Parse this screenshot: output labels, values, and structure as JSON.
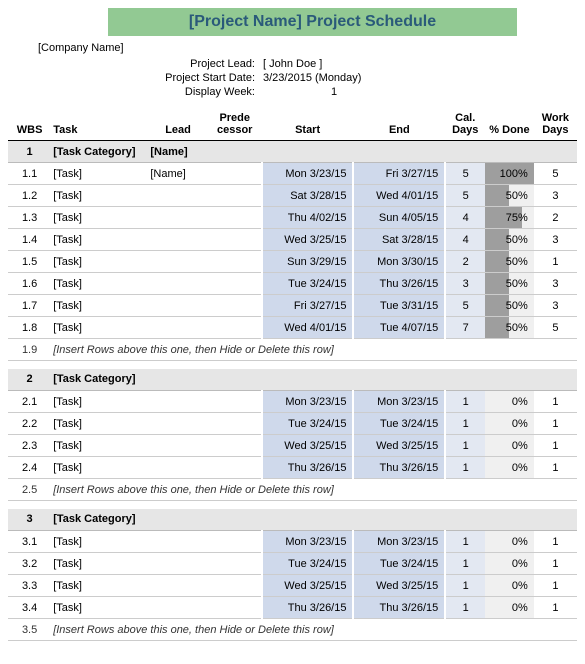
{
  "title": "[Project Name] Project Schedule",
  "company": "[Company Name]",
  "meta": {
    "lead_label": "Project Lead:",
    "lead_value": "[ John Doe ]",
    "start_label": "Project Start Date:",
    "start_value": "3/23/2015 (Monday)",
    "week_label": "Display Week:",
    "week_value": "1"
  },
  "headers": {
    "wbs": "WBS",
    "task": "Task",
    "lead": "Lead",
    "pred": "Prede cessor",
    "start": "Start",
    "end": "End",
    "cal": "Cal. Days",
    "pct": "% Done",
    "work": "Work Days"
  },
  "sections": [
    {
      "wbs": "1",
      "category": "[Task Category]",
      "lead": "[Name]",
      "rows": [
        {
          "wbs": "1.1",
          "task": "[Task]",
          "lead": "[Name]",
          "start": "Mon 3/23/15",
          "end": "Fri 3/27/15",
          "cal": "5",
          "pct": "100%",
          "pct_num": 100,
          "work": "5"
        },
        {
          "wbs": "1.2",
          "task": "[Task]",
          "lead": "",
          "start": "Sat 3/28/15",
          "end": "Wed 4/01/15",
          "cal": "5",
          "pct": "50%",
          "pct_num": 50,
          "work": "3"
        },
        {
          "wbs": "1.3",
          "task": "[Task]",
          "lead": "",
          "start": "Thu 4/02/15",
          "end": "Sun 4/05/15",
          "cal": "4",
          "pct": "75%",
          "pct_num": 75,
          "work": "2"
        },
        {
          "wbs": "1.4",
          "task": "[Task]",
          "lead": "",
          "start": "Wed 3/25/15",
          "end": "Sat 3/28/15",
          "cal": "4",
          "pct": "50%",
          "pct_num": 50,
          "work": "3"
        },
        {
          "wbs": "1.5",
          "task": "[Task]",
          "lead": "",
          "start": "Sun 3/29/15",
          "end": "Mon 3/30/15",
          "cal": "2",
          "pct": "50%",
          "pct_num": 50,
          "work": "1"
        },
        {
          "wbs": "1.6",
          "task": "[Task]",
          "lead": "",
          "start": "Tue 3/24/15",
          "end": "Thu 3/26/15",
          "cal": "3",
          "pct": "50%",
          "pct_num": 50,
          "work": "3"
        },
        {
          "wbs": "1.7",
          "task": "[Task]",
          "lead": "",
          "start": "Fri 3/27/15",
          "end": "Tue 3/31/15",
          "cal": "5",
          "pct": "50%",
          "pct_num": 50,
          "work": "3"
        },
        {
          "wbs": "1.8",
          "task": "[Task]",
          "lead": "",
          "start": "Wed 4/01/15",
          "end": "Tue 4/07/15",
          "cal": "7",
          "pct": "50%",
          "pct_num": 50,
          "work": "5"
        }
      ],
      "instruction_wbs": "1.9",
      "instruction": "[Insert Rows above this one, then Hide or Delete this row]"
    },
    {
      "wbs": "2",
      "category": "[Task Category]",
      "lead": "",
      "rows": [
        {
          "wbs": "2.1",
          "task": "[Task]",
          "lead": "",
          "start": "Mon 3/23/15",
          "end": "Mon 3/23/15",
          "cal": "1",
          "pct": "0%",
          "pct_num": 0,
          "work": "1"
        },
        {
          "wbs": "2.2",
          "task": "[Task]",
          "lead": "",
          "start": "Tue 3/24/15",
          "end": "Tue 3/24/15",
          "cal": "1",
          "pct": "0%",
          "pct_num": 0,
          "work": "1"
        },
        {
          "wbs": "2.3",
          "task": "[Task]",
          "lead": "",
          "start": "Wed 3/25/15",
          "end": "Wed 3/25/15",
          "cal": "1",
          "pct": "0%",
          "pct_num": 0,
          "work": "1"
        },
        {
          "wbs": "2.4",
          "task": "[Task]",
          "lead": "",
          "start": "Thu 3/26/15",
          "end": "Thu 3/26/15",
          "cal": "1",
          "pct": "0%",
          "pct_num": 0,
          "work": "1"
        }
      ],
      "instruction_wbs": "2.5",
      "instruction": "[Insert Rows above this one, then Hide or Delete this row]"
    },
    {
      "wbs": "3",
      "category": "[Task Category]",
      "lead": "",
      "rows": [
        {
          "wbs": "3.1",
          "task": "[Task]",
          "lead": "",
          "start": "Mon 3/23/15",
          "end": "Mon 3/23/15",
          "cal": "1",
          "pct": "0%",
          "pct_num": 0,
          "work": "1"
        },
        {
          "wbs": "3.2",
          "task": "[Task]",
          "lead": "",
          "start": "Tue 3/24/15",
          "end": "Tue 3/24/15",
          "cal": "1",
          "pct": "0%",
          "pct_num": 0,
          "work": "1"
        },
        {
          "wbs": "3.3",
          "task": "[Task]",
          "lead": "",
          "start": "Wed 3/25/15",
          "end": "Wed 3/25/15",
          "cal": "1",
          "pct": "0%",
          "pct_num": 0,
          "work": "1"
        },
        {
          "wbs": "3.4",
          "task": "[Task]",
          "lead": "",
          "start": "Thu 3/26/15",
          "end": "Thu 3/26/15",
          "cal": "1",
          "pct": "0%",
          "pct_num": 0,
          "work": "1"
        }
      ],
      "instruction_wbs": "3.5",
      "instruction": "[Insert Rows above this one, then Hide or Delete this row]"
    }
  ]
}
